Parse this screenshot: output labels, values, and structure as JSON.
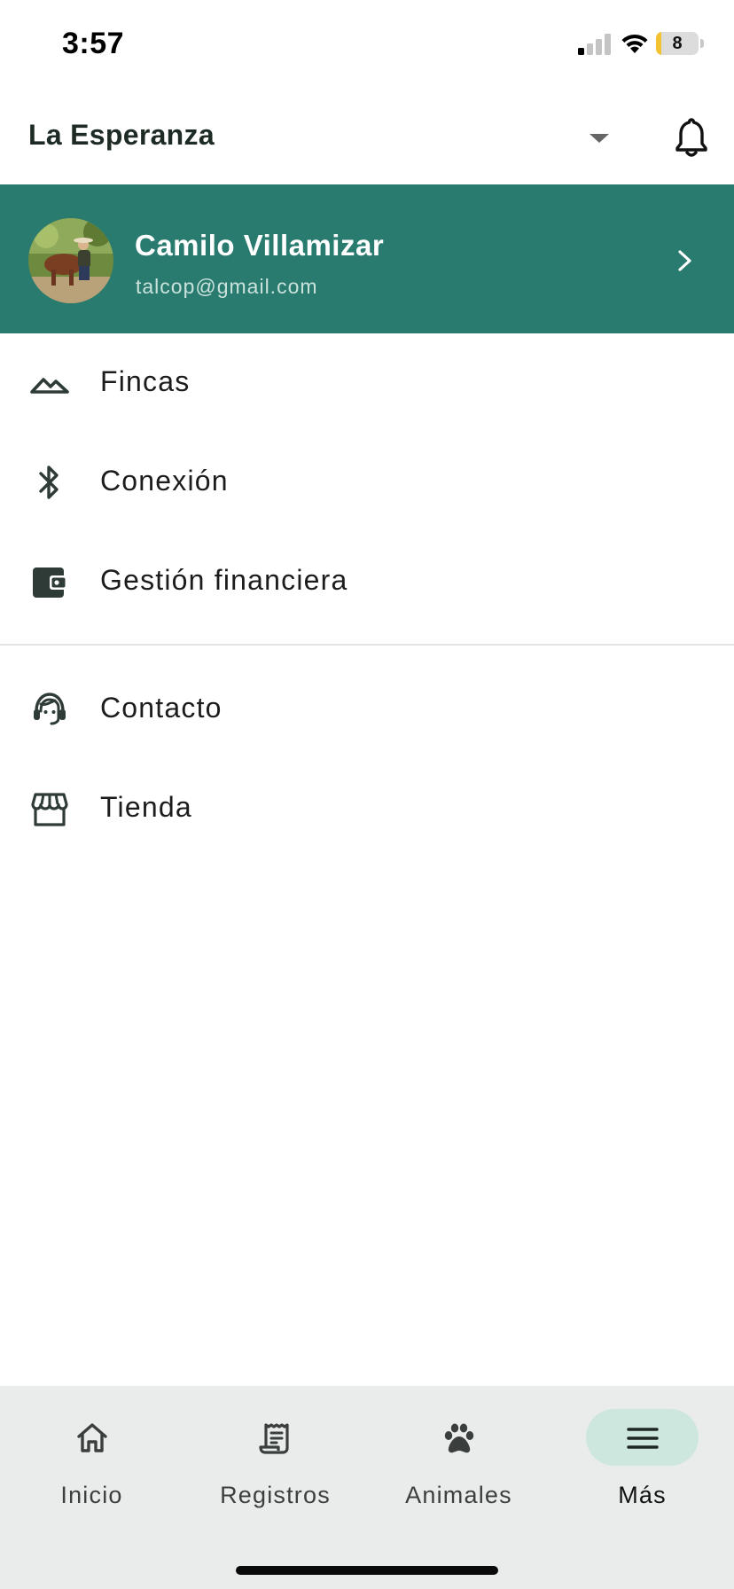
{
  "status_bar": {
    "time": "3:57",
    "battery_level": "8",
    "signal_bars_active": 1,
    "signal_bars_total": 4
  },
  "header": {
    "farm_name": "La Esperanza",
    "dropdown_icon": "caret-down-icon",
    "notification_icon": "bell-icon"
  },
  "profile": {
    "name": "Camilo Villamizar",
    "email": "talcop@gmail.com"
  },
  "menu": {
    "section1": [
      {
        "label": "Fincas",
        "icon": "mountain-icon"
      },
      {
        "label": "Conexión",
        "icon": "bluetooth-icon"
      },
      {
        "label": "Gestión financiera",
        "icon": "wallet-icon"
      }
    ],
    "section2": [
      {
        "label": "Contacto",
        "icon": "support-agent-icon"
      },
      {
        "label": "Tienda",
        "icon": "storefront-icon"
      }
    ]
  },
  "bottom_nav": {
    "items": [
      {
        "label": "Inicio",
        "icon": "home-icon",
        "active": false
      },
      {
        "label": "Registros",
        "icon": "receipt-icon",
        "active": false
      },
      {
        "label": "Animales",
        "icon": "paw-icon",
        "active": false
      },
      {
        "label": "Más",
        "icon": "menu-icon",
        "active": true
      }
    ]
  },
  "colors": {
    "primary": "#2a7b6f",
    "active_pill": "#cde7df",
    "nav_background": "#e9eceb",
    "battery": "#f2c230"
  }
}
